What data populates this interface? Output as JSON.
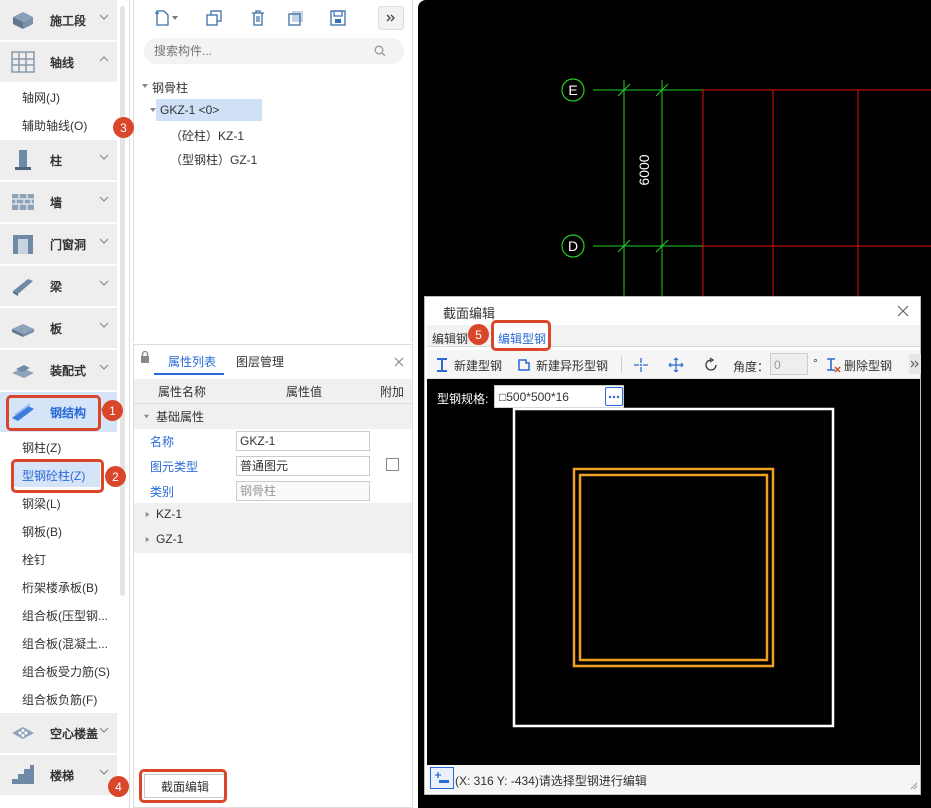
{
  "sidebar": {
    "categories": [
      {
        "label": "施工段",
        "icon": "construction-section-icon"
      },
      {
        "label": "轴线",
        "icon": "axis-grid-icon"
      },
      {
        "label": "柱",
        "icon": "column-icon"
      },
      {
        "label": "墙",
        "icon": "wall-icon"
      },
      {
        "label": "门窗洞",
        "icon": "door-window-icon"
      },
      {
        "label": "梁",
        "icon": "beam-icon"
      },
      {
        "label": "板",
        "icon": "slab-icon"
      },
      {
        "label": "装配式",
        "icon": "prefab-icon"
      },
      {
        "label": "钢结构",
        "icon": "steel-structure-icon"
      },
      {
        "label": "空心楼盖",
        "icon": "hollow-floor-icon"
      },
      {
        "label": "楼梯",
        "icon": "stair-icon"
      }
    ],
    "axis_items": [
      "轴网(J)",
      "辅助轴线(O)"
    ],
    "steel_items": [
      "钢柱(Z)",
      "型钢砼柱(Z)",
      "钢梁(L)",
      "钢板(B)",
      "栓钉",
      "桁架楼承板(B)",
      "组合板(压型钢...",
      "组合板(混凝土...",
      "组合板受力筋(S)",
      "组合板负筋(F)"
    ]
  },
  "tree": {
    "search_placeholder": "搜索构件...",
    "root": "钢骨柱",
    "selected": "GKZ-1 <0>",
    "children": [
      "（砼柱）KZ-1",
      "（型钢柱）GZ-1"
    ]
  },
  "props": {
    "tabs": [
      "属性列表",
      "图层管理"
    ],
    "headers": [
      "属性名称",
      "属性值",
      "附加"
    ],
    "group": "基础属性",
    "rows": [
      {
        "name": "名称",
        "value": "GKZ-1"
      },
      {
        "name": "图元类型",
        "value": "普通图元"
      },
      {
        "name": "类别",
        "value": "钢骨柱"
      }
    ],
    "groups_collapsed": [
      "KZ-1",
      "GZ-1"
    ],
    "section_edit_button": "截面编辑"
  },
  "viewport": {
    "axis_labels": [
      "E",
      "D"
    ],
    "dimension": "6000"
  },
  "dialog": {
    "title": "截面编辑",
    "tabs": [
      "编辑钢",
      "编辑型钢"
    ],
    "toolbar": {
      "new_steel": "新建型钢",
      "new_irregular_steel": "新建异形型钢",
      "angle_label": "角度：",
      "angle_value": "0",
      "degree": "°",
      "delete_steel": "删除型钢"
    },
    "spec_label": "型钢规格:",
    "spec_value": "□500*500*16",
    "status": "(X: 316 Y: -434)请选择型钢进行编辑"
  },
  "callouts": [
    "1",
    "2",
    "3",
    "4",
    "5"
  ],
  "colors": {
    "accent_blue": "#2a6ad6",
    "callout_red": "#d9462a",
    "steel_orange": "#f0a020",
    "grid_green": "#22cc22",
    "grid_red": "#e01010"
  }
}
